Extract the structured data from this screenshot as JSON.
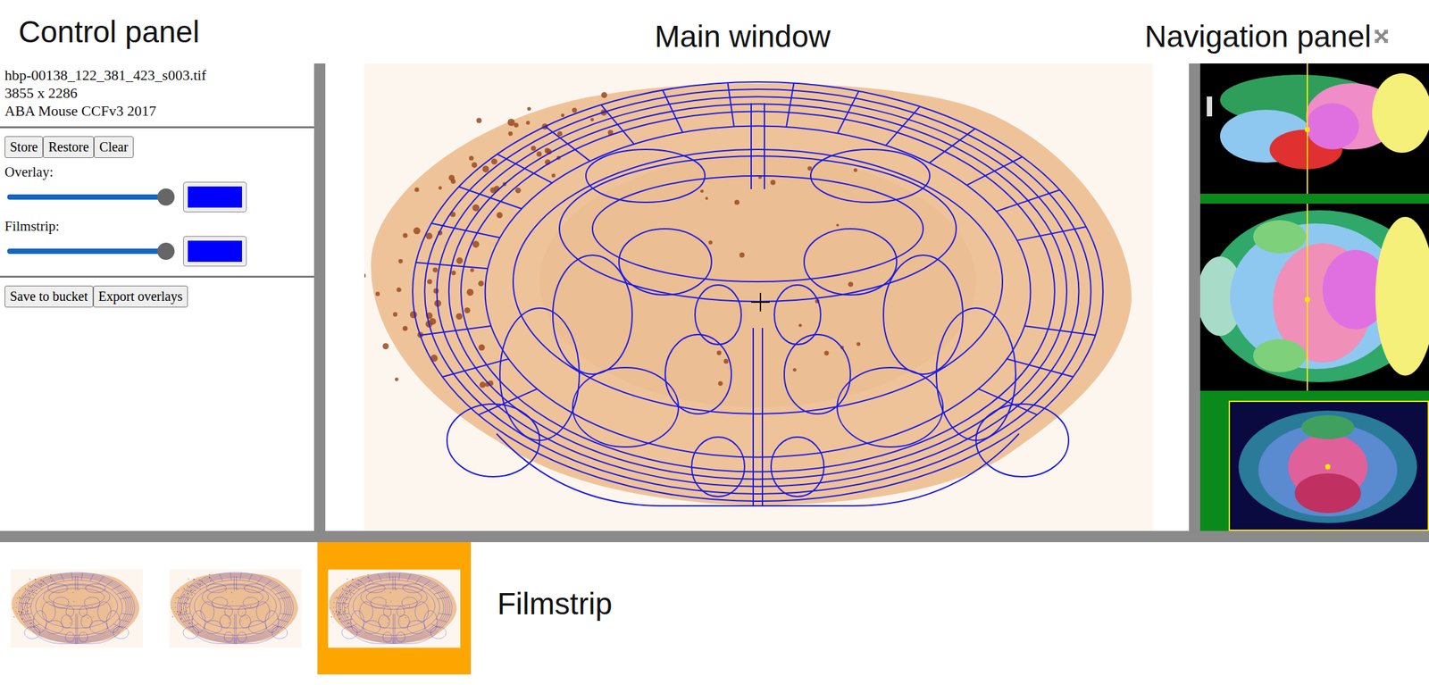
{
  "annotations": {
    "control_panel": "Control panel",
    "main_window": "Main window",
    "navigation_panel": "Navigation panel",
    "filmstrip": "Filmstrip"
  },
  "file": {
    "name": "hbp-00138_122_381_423_s003.tif",
    "size": "3855 x 2286",
    "atlas": "ABA Mouse CCFv3 2017"
  },
  "state_buttons": [
    "Store",
    "Restore",
    "Clear"
  ],
  "sliders": [
    {
      "label": "Overlay:",
      "level": 1,
      "color": "#0000ff"
    },
    {
      "label": "Filmstrip:",
      "level": 1,
      "color": "#0000ff"
    }
  ],
  "action_buttons": [
    "Save to bucket",
    "Export overlays"
  ],
  "filmstrip_items": [
    {
      "selected": false
    },
    {
      "selected": false
    },
    {
      "selected": true
    }
  ]
}
